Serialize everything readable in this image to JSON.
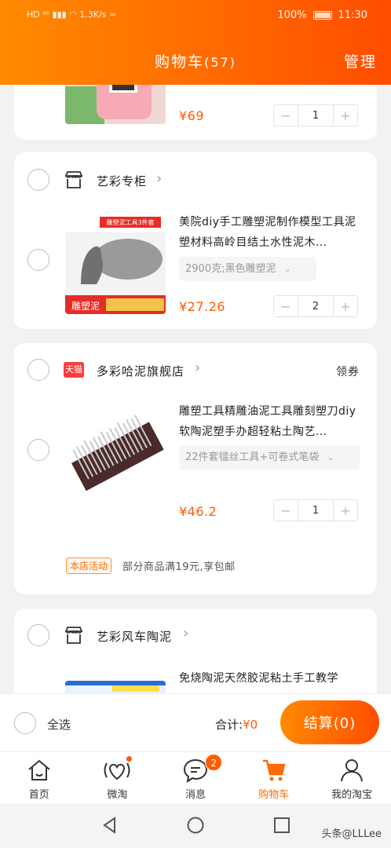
{
  "status_bar": {
    "left": "HD ⁴⁶ ▮▮▮ ◠ 1.3K/s ≈",
    "battery_pct": "100%",
    "time": "11:30"
  },
  "header": {
    "title": "购物车",
    "count": "(57)",
    "manage": "管理"
  },
  "top_card": {
    "price": "¥69",
    "qty": "1"
  },
  "shops": [
    {
      "name": "艺彩专柜",
      "items": [
        {
          "title": "美院diy手工雕塑泥制作模型工具泥塑材料高岭目结土水性泥木…",
          "sku": "2900克;黑色雕塑泥",
          "price": "¥27.26",
          "qty": "2",
          "thumb_top": "雕塑泥工具3件套",
          "thumb_bottom": "雕塑泥"
        }
      ]
    },
    {
      "name": "多彩哈泥旗舰店",
      "tmall_label": "天猫",
      "coupon": "领券",
      "items": [
        {
          "title": "雕塑工具精雕油泥工具雕刻塑刀diy软陶泥塑手办超轻粘土陶艺…",
          "sku": "22件套镭丝工具+可卷式笔袋",
          "price": "¥46.2",
          "qty": "1"
        }
      ],
      "promo": {
        "tag": "本店活动",
        "text": "部分商品满19元,享包邮"
      }
    },
    {
      "name": "艺彩风车陶泥",
      "items": [
        {
          "title": "免烧陶泥天然胶泥粘土手工教学"
        }
      ]
    }
  ],
  "stepper": {
    "minus": "−",
    "plus": "+"
  },
  "checkout": {
    "select_all": "全选",
    "total_label": "合计:",
    "total_value": "¥0",
    "button": "结算(0)"
  },
  "tabs": [
    {
      "label": "首页",
      "icon": "home-icon"
    },
    {
      "label": "微淘",
      "icon": "heart-wave-icon"
    },
    {
      "label": "消息",
      "icon": "message-icon",
      "badge": "2"
    },
    {
      "label": "购物车",
      "icon": "cart-icon"
    },
    {
      "label": "我的淘宝",
      "icon": "user-icon"
    }
  ],
  "watermark": "头条@LLLee",
  "colors": {
    "accent": "#ff6a00",
    "price": "#ff5a00"
  }
}
